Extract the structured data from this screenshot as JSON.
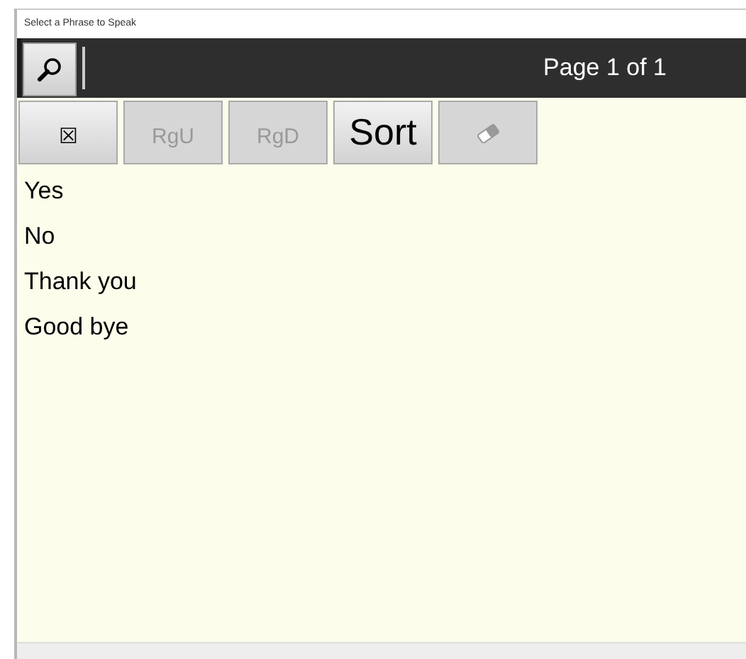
{
  "window": {
    "title": "Select a Phrase to Speak"
  },
  "header": {
    "page_label": "Page 1 of 1"
  },
  "toolbar": [
    {
      "kind": "caption",
      "label": "☒",
      "disabled": false
    },
    {
      "kind": "caption",
      "label": "RgU",
      "disabled": true
    },
    {
      "kind": "caption",
      "label": "RgD",
      "disabled": true
    },
    {
      "kind": "title",
      "label": "Sort",
      "disabled": false
    },
    {
      "kind": "eraser",
      "disabled": true
    }
  ],
  "phrases": [
    "Yes",
    "No",
    "Thank you",
    "Good bye"
  ]
}
